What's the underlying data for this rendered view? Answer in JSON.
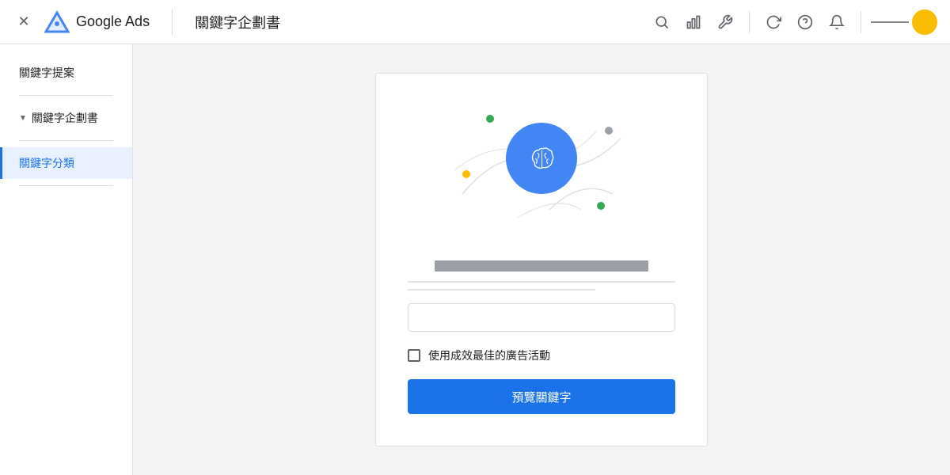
{
  "topbar": {
    "close_label": "✕",
    "logo_text": "Google Ads",
    "divider": "|",
    "page_title": "關鍵字企劃書",
    "icons": {
      "search": "🔍",
      "chart": "📊",
      "wrench": "🔧",
      "refresh": "↻",
      "help": "?",
      "bell": "🔔"
    }
  },
  "sidebar": {
    "item1": "關鍵字提案",
    "divider1": "",
    "section_header": "關鍵字企劃書",
    "divider2": "",
    "item_active": "關鍵字分類",
    "divider3": ""
  },
  "card": {
    "input_bar_label": "",
    "checkbox_label": "使用成效最佳的廣告活動",
    "button_label": "預覽關鍵字"
  }
}
